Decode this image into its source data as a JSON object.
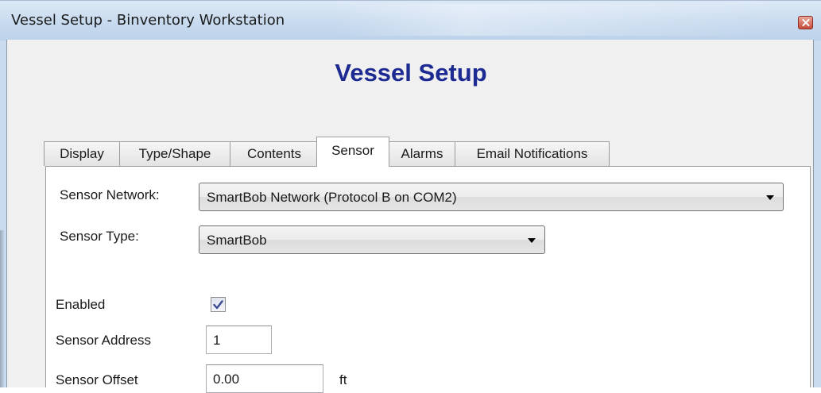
{
  "window": {
    "title": "Vessel Setup - Binventory Workstation",
    "close_icon": "close-icon",
    "close_color": "#c94a3b"
  },
  "heading": "Vessel Setup",
  "heading_color": "#1c2a92",
  "tabs": [
    {
      "label": "Display",
      "active": false
    },
    {
      "label": "Type/Shape",
      "active": false
    },
    {
      "label": "Contents",
      "active": false
    },
    {
      "label": "Sensor",
      "active": true
    },
    {
      "label": "Alarms",
      "active": false
    },
    {
      "label": "Email Notifications",
      "active": false
    }
  ],
  "sensor": {
    "network_label": "Sensor Network:",
    "network_value": "SmartBob Network (Protocol B on COM2)",
    "type_label": "Sensor Type:",
    "type_value": "SmartBob",
    "enabled_label": "Enabled",
    "enabled_checked": true,
    "address_label": "Sensor Address",
    "address_value": "1",
    "offset_label": "Sensor Offset",
    "offset_value": "0.00",
    "offset_unit": "ft"
  }
}
